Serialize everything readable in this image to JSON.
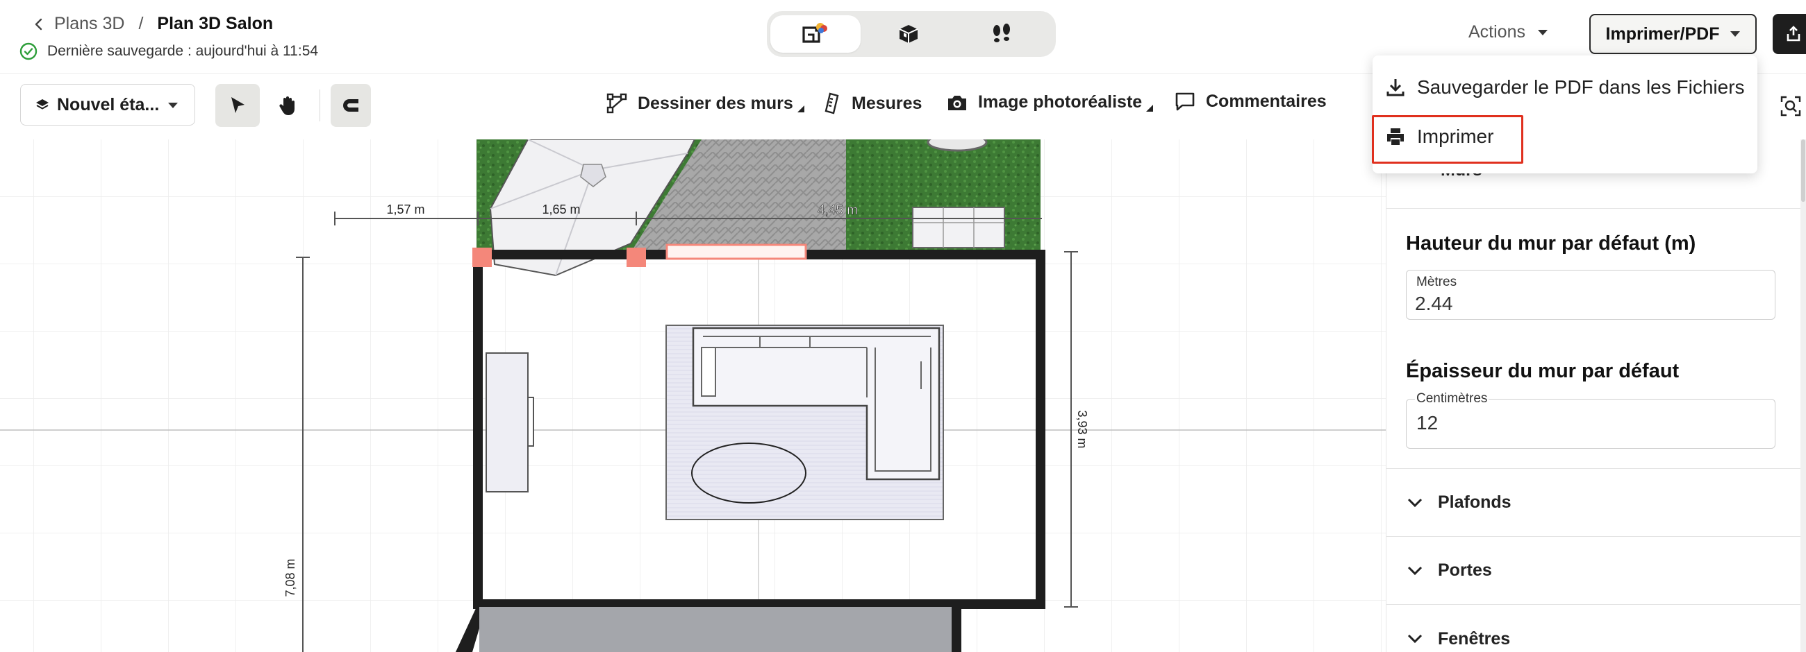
{
  "header": {
    "breadcrumb_back": "Plans 3D",
    "breadcrumb_separator": "/",
    "breadcrumb_current": "Plan 3D Salon",
    "save_status": "Dernière sauvegarde : aujourd'hui à 11:54",
    "view_modes": [
      {
        "icon": "2d-view-icon",
        "active": true
      },
      {
        "icon": "3d-view-icon",
        "active": false
      },
      {
        "icon": "walkthrough-icon",
        "active": false
      }
    ],
    "actions_label": "Actions",
    "print_pdf_label": "Imprimer/PDF",
    "share_icon": "export-icon"
  },
  "toolbar": {
    "level_select": "Nouvel éta...",
    "tools": {
      "draw_walls": "Dessiner des murs",
      "measures": "Mesures",
      "photo_image": "Image photoréaliste",
      "comments": "Commentaires"
    }
  },
  "menu": {
    "items": [
      {
        "label": "Sauvegarder le PDF dans les Fichiers",
        "icon": "download-icon"
      },
      {
        "label": "Imprimer",
        "icon": "printer-icon",
        "highlighted": true
      }
    ]
  },
  "panel": {
    "walls_section_label": "Murs",
    "wall_height_title": "Hauteur du mur par défaut (m)",
    "wall_height_unit": "Mètres",
    "wall_height_value": "2.44",
    "wall_thickness_title": "Épaisseur du mur par défaut",
    "wall_thickness_unit": "Centimètres",
    "wall_thickness_value": "12",
    "accordions": [
      "Plafonds",
      "Portes",
      "Fenêtres"
    ]
  },
  "plan": {
    "dimensions": {
      "d1": "1,57 m",
      "d2": "1,65 m",
      "d3": "4,45 m",
      "d4": "3,93 m",
      "d5": "7,08 m"
    }
  },
  "colors": {
    "highlight": "#e0301e",
    "wall": "#1e1e1e",
    "grass": "#3f7a36",
    "handle": "#f4877a"
  }
}
